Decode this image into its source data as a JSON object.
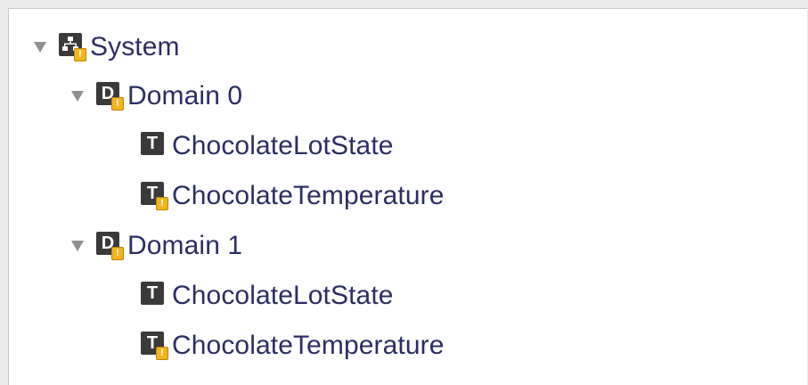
{
  "tree": {
    "root": {
      "label": "System",
      "icon": "system-icon",
      "badge": "!",
      "expanded": true
    },
    "domains": [
      {
        "label": "Domain 0",
        "icon": "domain-icon",
        "icon_letter": "D",
        "badge": "!",
        "expanded": true,
        "topics": [
          {
            "label": "ChocolateLotState",
            "icon": "topic-icon",
            "icon_letter": "T"
          },
          {
            "label": "ChocolateTemperature",
            "icon": "topic-icon",
            "icon_letter": "T",
            "badge": "!"
          }
        ]
      },
      {
        "label": "Domain 1",
        "icon": "domain-icon",
        "icon_letter": "D",
        "badge": "!",
        "expanded": true,
        "topics": [
          {
            "label": "ChocolateLotState",
            "icon": "topic-icon",
            "icon_letter": "T"
          },
          {
            "label": "ChocolateTemperature",
            "icon": "topic-icon",
            "icon_letter": "T",
            "badge": "!"
          }
        ]
      }
    ],
    "colors": {
      "label_text": "#2b2f63",
      "icon_bg": "#3a3a3a",
      "warning_badge": "#f3b51f",
      "disclosure": "#8f8f8f"
    }
  }
}
